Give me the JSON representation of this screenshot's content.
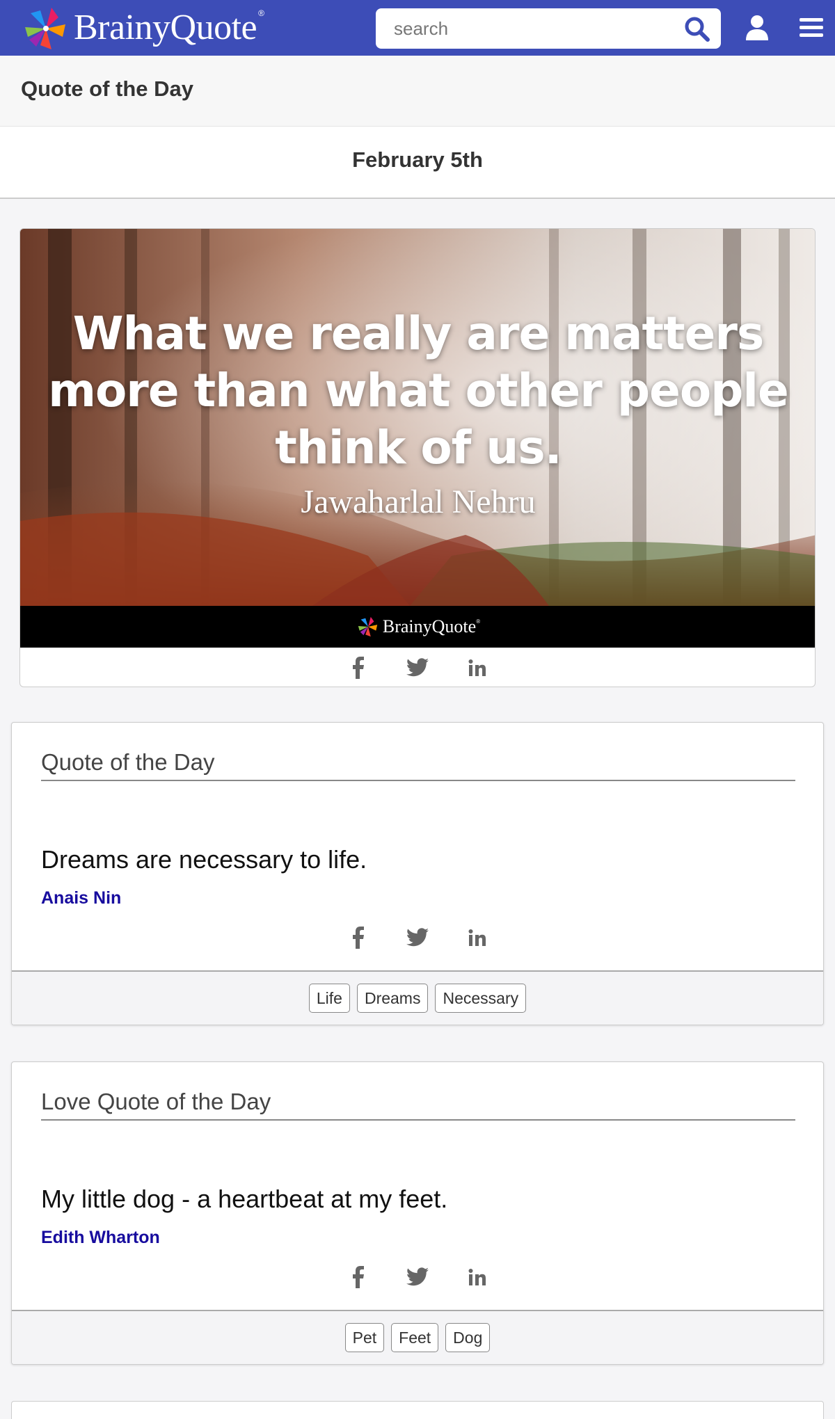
{
  "header": {
    "logo_text": "BrainyQuote",
    "logo_reg": "®",
    "search_placeholder": "search",
    "brand_color": "#3d4db7"
  },
  "page": {
    "title": "Quote of the Day",
    "date": "February 5th"
  },
  "image_quote": {
    "text": "What we really are matters more than what other people think of us.",
    "author": "Jawaharlal Nehru",
    "footer_logo": "BrainyQuote",
    "footer_reg": "®"
  },
  "share_icons": [
    "facebook-icon",
    "twitter-icon",
    "linkedin-icon"
  ],
  "cards": [
    {
      "heading": "Quote of the Day",
      "quote": "Dreams are necessary to life.",
      "author": "Anais Nin",
      "tags": [
        "Life",
        "Dreams",
        "Necessary"
      ]
    },
    {
      "heading": "Love Quote of the Day",
      "quote": "My little dog - a heartbeat at my feet.",
      "author": "Edith Wharton",
      "tags": [
        "Pet",
        "Feet",
        "Dog"
      ]
    }
  ]
}
